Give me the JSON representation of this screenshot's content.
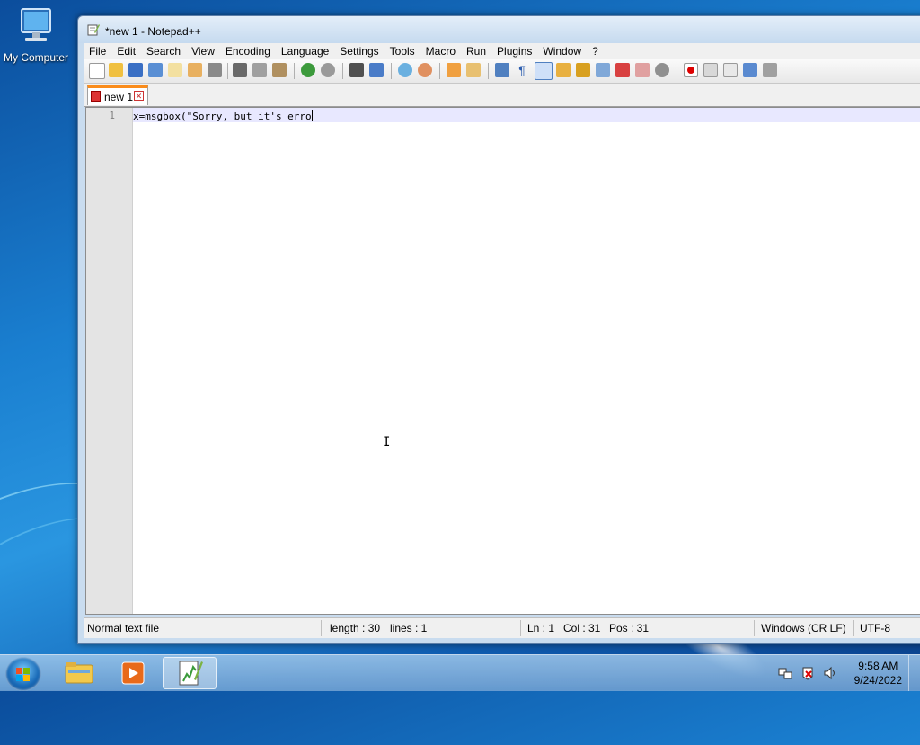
{
  "desktop": {
    "icon_label": "My Computer"
  },
  "window": {
    "title": "*new 1 - Notepad++"
  },
  "menu": [
    "File",
    "Edit",
    "Search",
    "View",
    "Encoding",
    "Language",
    "Settings",
    "Tools",
    "Macro",
    "Run",
    "Plugins",
    "Window",
    "?"
  ],
  "toolbar_icons": [
    "new-file-icon",
    "open-file-icon",
    "save-icon",
    "save-all-icon",
    "close-icon",
    "close-all-icon",
    "print-icon",
    "cut-icon",
    "copy-icon",
    "paste-icon",
    "undo-icon",
    "redo-icon",
    "find-icon",
    "replace-icon",
    "zoom-in-icon",
    "zoom-out-icon",
    "sync-vertical-icon",
    "sync-horizontal-icon",
    "word-wrap-icon",
    "show-all-chars-icon",
    "indent-guide-icon",
    "udl-icon",
    "function-list-icon",
    "doc-map-icon",
    "folder-workspace-icon",
    "monitor-icon",
    "bubble-icon",
    "record-macro-icon",
    "stop-record-icon",
    "play-macro-icon",
    "run-macro-multiple-icon",
    "save-macro-icon"
  ],
  "tab": {
    "label": "new 1"
  },
  "editor": {
    "line_number": "1",
    "content": "x=msgbox(\"Sorry, but it's erro"
  },
  "status": {
    "file_type": "Normal text file",
    "length": "length : 30",
    "lines": "lines : 1",
    "ln": "Ln : 1",
    "col": "Col : 31",
    "pos": "Pos : 31",
    "eol": "Windows (CR LF)",
    "encoding": "UTF-8"
  },
  "taskbar": {
    "time": "9:58 AM",
    "date": "9/24/2022"
  }
}
